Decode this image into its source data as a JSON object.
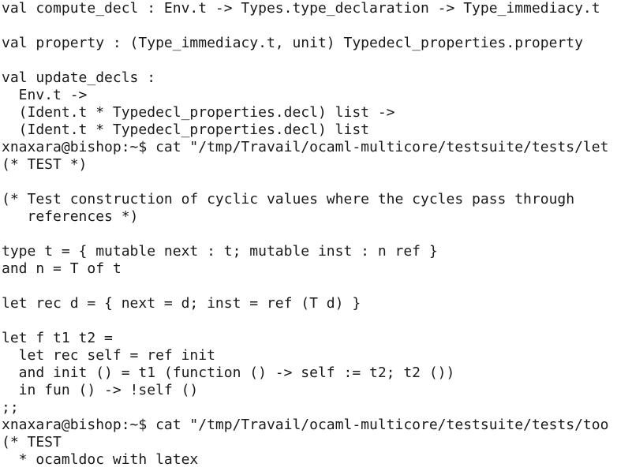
{
  "terminal": {
    "lines": [
      "val compute_decl : Env.t -> Types.type_declaration -> Type_immediacy.t",
      "",
      "val property : (Type_immediacy.t, unit) Typedecl_properties.property",
      "",
      "val update_decls :",
      "  Env.t ->",
      "  (Ident.t * Typedecl_properties.decl) list ->",
      "  (Ident.t * Typedecl_properties.decl) list",
      "xnaxara@bishop:~$ cat \"/tmp/Travail/ocaml-multicore/testsuite/tests/let",
      "(* TEST *)",
      "",
      "(* Test construction of cyclic values where the cycles pass through",
      "   references *)",
      "",
      "type t = { mutable next : t; mutable inst : n ref }",
      "and n = T of t",
      "",
      "let rec d = { next = d; inst = ref (T d) }",
      "",
      "let f t1 t2 =",
      "  let rec self = ref init",
      "  and init () = t1 (function () -> self := t2; t2 ())",
      "  in fun () -> !self ()",
      ";;",
      "xnaxara@bishop:~$ cat \"/tmp/Travail/ocaml-multicore/testsuite/tests/too",
      "(* TEST",
      "  * ocamldoc with latex"
    ]
  }
}
